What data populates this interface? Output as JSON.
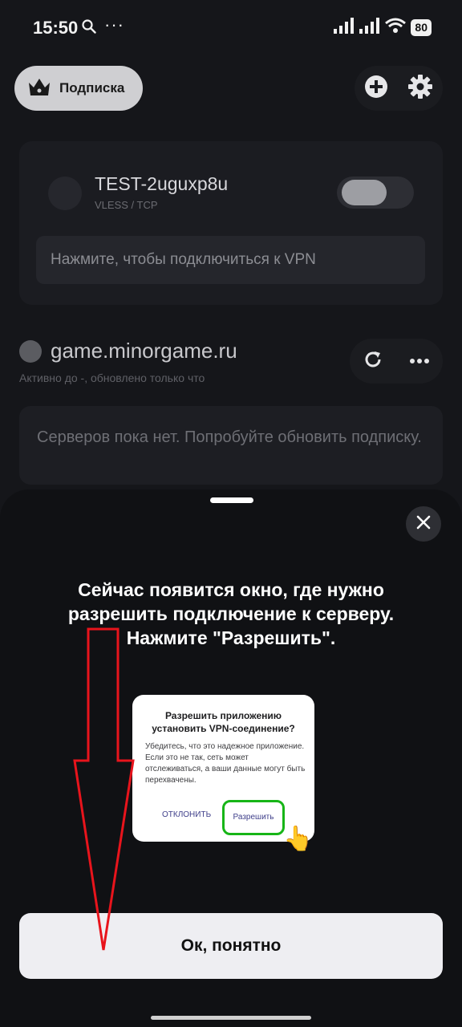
{
  "status_bar": {
    "time": "15:50",
    "dots": "···",
    "battery": "80"
  },
  "header": {
    "subscription_label": "Подписка"
  },
  "server_card": {
    "name": "TEST-2uguxp8u",
    "protocol": "VLESS / TCP",
    "connect_hint": "Нажмите, чтобы подключиться к VPN"
  },
  "subscription_group": {
    "name": "game.minorgame.ru",
    "subtitle": "Активно до -, обновлено только что",
    "empty_message": "Серверов пока нет. Попробуйте обновить подписку."
  },
  "sheet": {
    "title": "Сейчас появится окно, где нужно разрешить подключение к серверу. Нажмите \"Разрешить\".",
    "ok_label": "Ок, понятно"
  },
  "example_dialog": {
    "title": "Разрешить приложению установить VPN-соединение?",
    "body": "Убедитесь, что это надежное приложение. Если это не так, сеть может отслеживаться, а ваши данные могут быть перехвачены.",
    "decline_label": "ОТКЛОНИТЬ",
    "allow_label": "Разрешить"
  },
  "colors": {
    "highlight_green": "#17b517",
    "arrow_red": "#e8141c"
  }
}
